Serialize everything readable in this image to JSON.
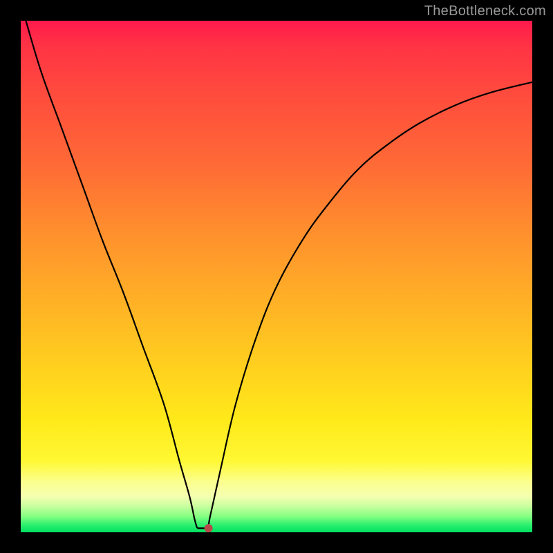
{
  "watermark": "TheBottleneck.com",
  "colors": {
    "frame": "#000000",
    "curve": "#000000",
    "marker": "#b64a4a",
    "gradient_top": "#ff1a4d",
    "gradient_bottom": "#00e060"
  },
  "chart_data": {
    "type": "line",
    "title": "",
    "xlabel": "",
    "ylabel": "",
    "xlim": [
      0,
      100
    ],
    "ylim": [
      0,
      100
    ],
    "grid": false,
    "legend": false,
    "series": [
      {
        "name": "bottleneck-curve",
        "x": [
          1,
          4,
          8,
          12,
          16,
          20,
          24,
          28,
          31,
          33,
          34,
          34.5,
          35.5,
          36.7,
          37,
          39,
          42,
          46,
          50,
          55,
          60,
          66,
          72,
          78,
          85,
          92,
          100
        ],
        "y": [
          100,
          90,
          79,
          68,
          57,
          47,
          36,
          25,
          14,
          7,
          2.5,
          0.8,
          0.8,
          0.8,
          3,
          12,
          25,
          38,
          48,
          57,
          64,
          71,
          76,
          80,
          83.5,
          86,
          88
        ]
      }
    ],
    "marker": {
      "x": 36.7,
      "y": 0.8,
      "color": "#b64a4a",
      "radius_px": 6
    }
  }
}
